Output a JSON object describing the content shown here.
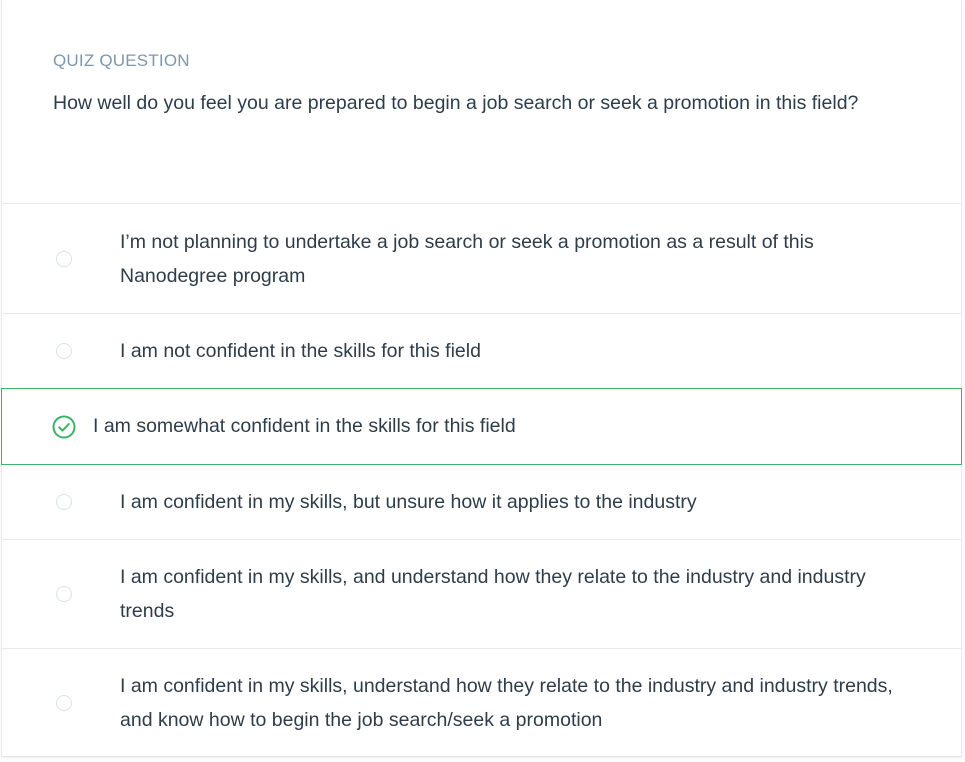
{
  "quiz": {
    "label": "QUIZ QUESTION",
    "question": "How well do you feel you are prepared to begin a job search or seek a promotion in this field?"
  },
  "options": [
    {
      "text": "I’m not planning to undertake a job search or seek a promotion as a result of this Nanodegree program",
      "selected": false
    },
    {
      "text": "I am not confident in the skills for this field",
      "selected": false
    },
    {
      "text": "I am somewhat confident in the skills for this field",
      "selected": true
    },
    {
      "text": "I am confident in my skills, but unsure how it applies to the industry",
      "selected": false
    },
    {
      "text": "I am confident in my skills, and understand how they relate to the industry and industry trends",
      "selected": false
    },
    {
      "text": "I am confident in my skills, understand how they relate to the industry and industry trends, and know how to begin the job search/seek a promotion",
      "selected": false
    }
  ],
  "colors": {
    "accent_selected": "#3bb36a",
    "label": "#7d97ad",
    "text": "#2e3d49"
  },
  "icons": {
    "selected": "check-circle-icon",
    "unselected": "radio-empty-icon"
  }
}
